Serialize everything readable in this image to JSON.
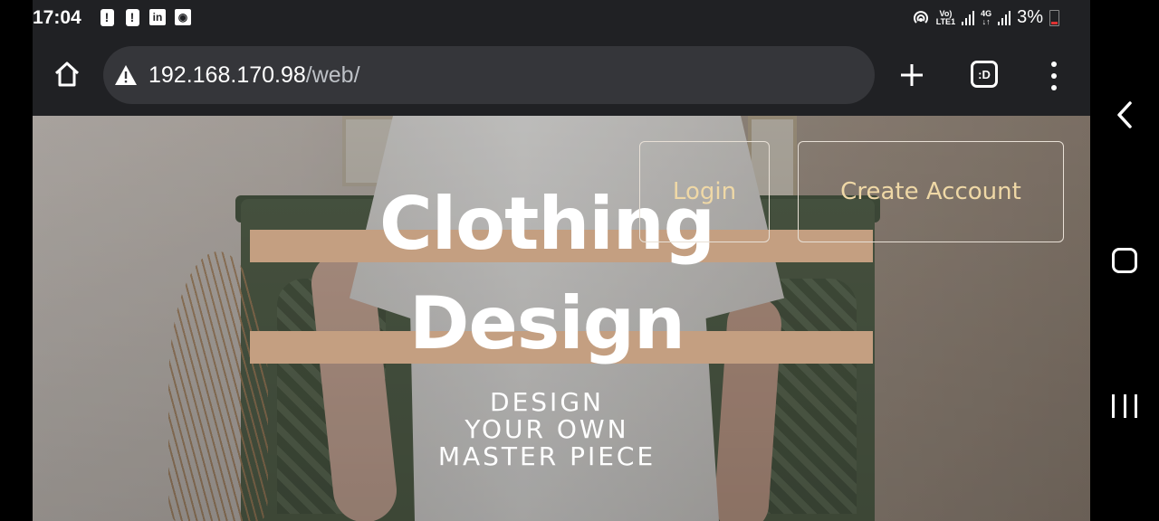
{
  "status_bar": {
    "time": "17:04",
    "notification_icons": [
      "alert-icon",
      "alert-icon",
      "linkedin-icon",
      "notification-icon"
    ],
    "notification_glyphs": [
      "!",
      "!",
      "in",
      "◉"
    ],
    "network_label_top": "Vo)",
    "network_label_bottom": "LTE1",
    "network_type_top": "4G",
    "network_type_bottom": "↓↑",
    "battery_percent": "3%"
  },
  "browser": {
    "url_host": "192.168.170.98",
    "url_path": "/web/",
    "tabs_label": ":D"
  },
  "hero": {
    "title_line1": "Clothing",
    "title_line2": "Design",
    "subtitle_line1": "DESIGN",
    "subtitle_line2": "YOUR OWN",
    "subtitle_line3": "MASTER PIECE",
    "login_label": "Login",
    "create_account_label": "Create Account",
    "accent_color": "#c49f81",
    "button_text_color": "#efd8a6"
  }
}
